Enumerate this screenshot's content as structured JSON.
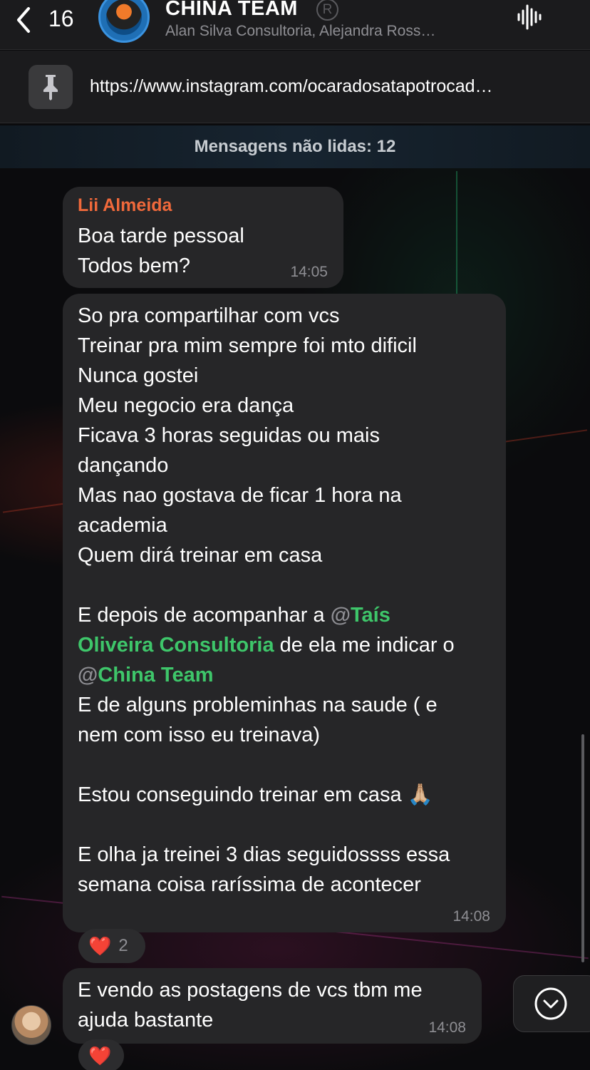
{
  "header": {
    "back_count": "16",
    "title": "CHINA TEAM",
    "subtitle": "Alan Silva Consultoria, Alejandra Ross…",
    "reg_mark": "R"
  },
  "pinned": {
    "text": "https://www.instagram.com/ocaradosatapotrocad…"
  },
  "unread": {
    "label": "Mensagens não lidas: 12"
  },
  "messages": [
    {
      "sender": "Lii Almeida",
      "text": "Boa tarde pessoal\nTodos bem?",
      "time": "14:05"
    },
    {
      "text_part1": "So pra compartilhar com vcs\nTreinar pra mim sempre foi mto dificil\nNunca gostei\nMeu negocio era dança\nFicava 3 horas seguidas ou mais\ndançando\nMas nao gostava de ficar 1 hora na\nacademia\nQuem dirá treinar em casa\n\nE depois de acompanhar a ",
      "at1": "@",
      "mention1": "Taís\nOliveira Consultoria",
      "text_part2": " de ela me indicar o\n",
      "at2": "@",
      "mention2": "China Team",
      "text_part3": "\nE de alguns probleminhas na saude ( e\nnem com isso eu treinava)\n\nEstou conseguindo treinar em casa 🙏🏼\n\nE olha ja treinei 3 dias seguidossss essa\nsemana coisa raríssima de acontecer",
      "time": "14:08",
      "reaction_emoji": "❤️",
      "reaction_count": "2"
    },
    {
      "text": "E vendo as postagens de vcs tbm me\najuda bastante",
      "time": "14:08",
      "reaction_emoji": "❤️"
    }
  ],
  "colors": {
    "sender_name": "#f0693b",
    "mention": "#3ec66a",
    "bubble": "#262628",
    "background": "#0b0b0d"
  },
  "icons": [
    "chevron-left-icon",
    "registered-icon",
    "voice-chat-icon",
    "pin-icon",
    "chevron-down-icon",
    "heart-icon"
  ]
}
